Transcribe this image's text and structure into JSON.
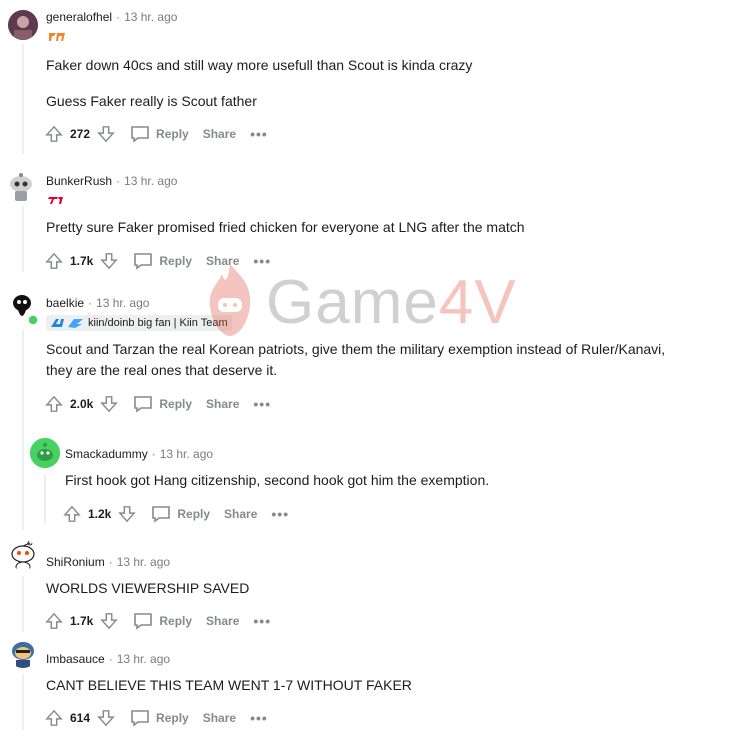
{
  "comments": [
    {
      "author": "generalofhel",
      "time": "13 hr. ago",
      "flair": "",
      "paragraphs": [
        "Faker down 40cs and still way more usefull than Scout is kinda crazy",
        "Guess Faker really is Scout father"
      ],
      "votes": "272",
      "reply": "Reply",
      "share": "Share"
    },
    {
      "author": "BunkerRush",
      "time": "13 hr. ago",
      "flair": "",
      "paragraphs": [
        "Pretty sure Faker promised fried chicken for everyone at LNG after the match"
      ],
      "votes": "1.7k",
      "reply": "Reply",
      "share": "Share"
    },
    {
      "author": "baelkie",
      "time": "13 hr. ago",
      "flair": "kiin/doinb big fan | Kiin Team",
      "paragraphs": [
        "Scout and Tarzan the real Korean patriots, give them the military exemption instead of Ruler/Kanavi, they are the real ones that deserve it."
      ],
      "votes": "2.0k",
      "reply": "Reply",
      "share": "Share"
    },
    {
      "author": "Smackadummy",
      "time": "13 hr. ago",
      "flair": "",
      "paragraphs": [
        "First hook got Hang citizenship, second hook got him the exemption."
      ],
      "votes": "1.2k",
      "reply": "Reply",
      "share": "Share"
    },
    {
      "author": "ShiRonium",
      "time": "13 hr. ago",
      "flair": "",
      "paragraphs": [
        "WORLDS VIEWERSHIP SAVED"
      ],
      "votes": "1.7k",
      "reply": "Reply",
      "share": "Share"
    },
    {
      "author": "Imbasauce",
      "time": "13 hr. ago",
      "flair": "",
      "paragraphs": [
        "CANT BELIEVE THIS TEAM WENT 1-7 WITHOUT FAKER"
      ],
      "votes": "614",
      "reply": "Reply",
      "share": "Share"
    }
  ],
  "separator": "·",
  "more": "•••",
  "watermark": {
    "main": "Game",
    "accent": "4V"
  },
  "colors": {
    "meta": "#7c7c7c",
    "action": "#878a8c",
    "accent": "#e15c48"
  }
}
